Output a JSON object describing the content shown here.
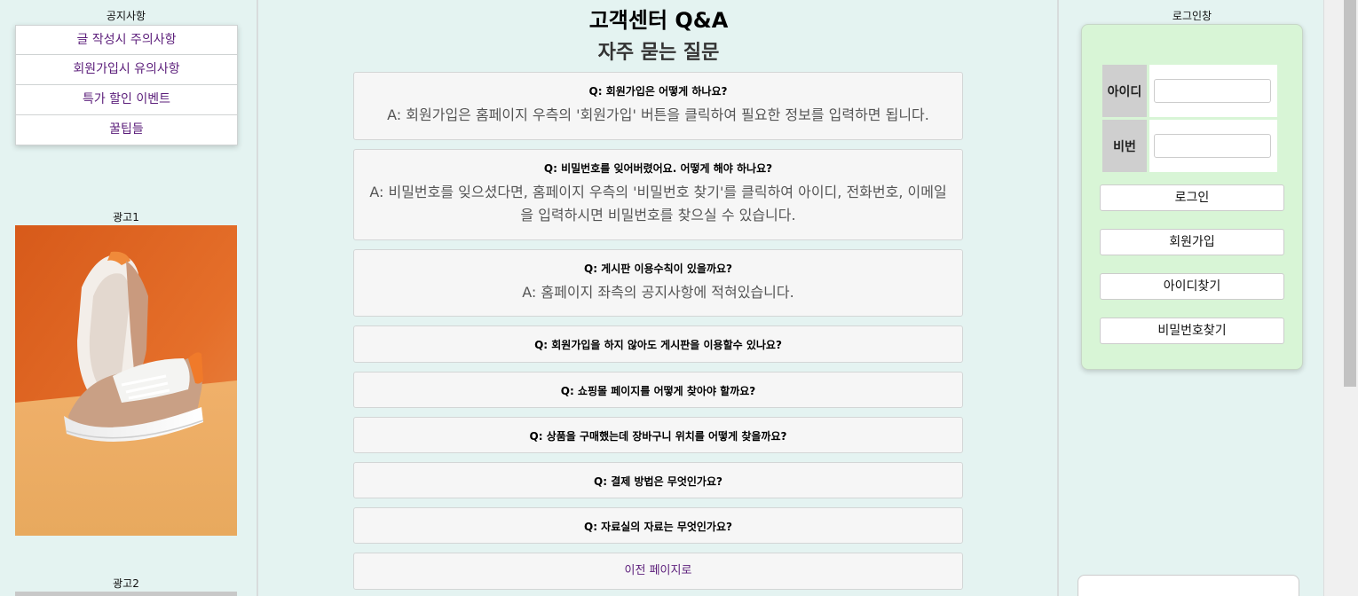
{
  "sidebar": {
    "notice_title": "공지사항",
    "notices": [
      {
        "label": "글 작성시 주의사항"
      },
      {
        "label": "회원가입시 유의사항"
      },
      {
        "label": "특가 할인 이벤트"
      },
      {
        "label": "꿀팁들"
      }
    ],
    "ad1_title": "광고1",
    "ad2_title": "광고2"
  },
  "main": {
    "title": "고객센터 Q&A",
    "subtitle": "자주 묻는 질문",
    "faqs": [
      {
        "q": "Q: 회원가입은 어떻게 하나요?",
        "a": "A: 회원가입은 홈페이지 우측의 '회원가입' 버튼을 클릭하여 필요한 정보를 입력하면 됩니다."
      },
      {
        "q": "Q: 비밀번호를 잊어버렸어요. 어떻게 해야 하나요?",
        "a": "A: 비밀번호를 잊으셨다면, 홈페이지 우측의 '비밀번호 찾기'를 클릭하여 아이디, 전화번호, 이메일을 입력하시면 비밀번호를 찾으실 수 있습니다."
      },
      {
        "q": "Q: 게시판 이용수칙이 있을까요?",
        "a": "A: 홈페이지 좌측의 공지사항에 적혀있습니다."
      },
      {
        "q": "Q: 회원가입을 하지 않아도 게시판을 이용할수 있나요?"
      },
      {
        "q": "Q: 쇼핑몰 페이지를 어떻게 찾아야 할까요?"
      },
      {
        "q": "Q: 상품을 구매했는데 장바구니 위치를 어떻게 찾을까요?"
      },
      {
        "q": "Q: 결제 방법은 무엇인가요?"
      },
      {
        "q": "Q: 자료실의 자료는 무엇인가요?"
      }
    ],
    "back_label": "이전 페이지로"
  },
  "login": {
    "title": "로그인창",
    "id_label": "아이디",
    "pw_label": "비번",
    "buttons": {
      "login": "로그인",
      "signup": "회원가입",
      "find_id": "아이디찾기",
      "find_pw": "비밀번호찾기"
    }
  },
  "colors": {
    "background": "#e4f3f1",
    "login_panel": "#d8f5d6",
    "link_purple": "#5b1d7a"
  }
}
